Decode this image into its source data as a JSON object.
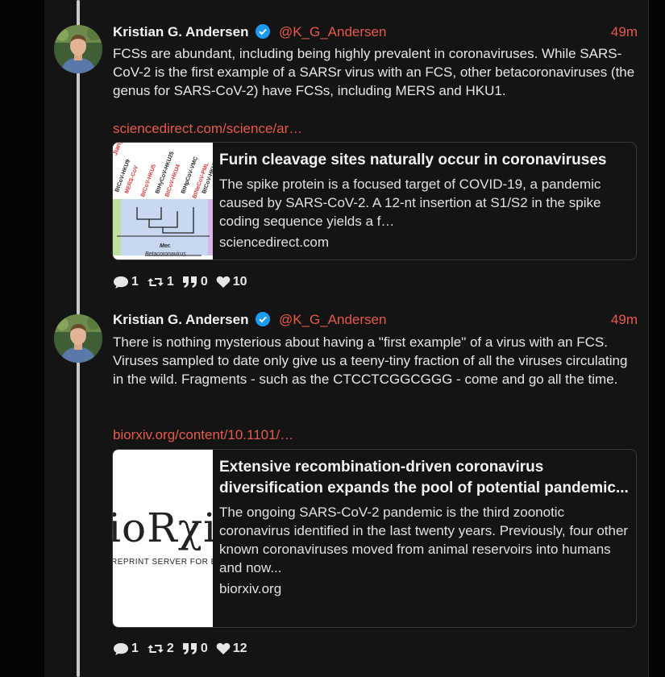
{
  "tweets": [
    {
      "author_name": "Kristian G. Andersen",
      "handle": "@K_G_Andersen",
      "time": "49m",
      "text": "FCSs are abundant, including being highly prevalent in coronaviruses. While SARS-CoV-2 is the first example of a SARSr virus with an FCS, other betacoronaviruses (the genus for SARS-CoV-2) have FCSs, including MERS and HKU1.",
      "link": "sciencedirect.com/science/ar…",
      "card": {
        "title": "Furin cleavage sites naturally occur in coronaviruses",
        "description": "The spike protein is a focused target of COVID-19, a pandemic caused by SARS-CoV-2. A 12-nt insertion at S1/S2 in the spike coding sequence yields a f…",
        "domain": "sciencedirect.com",
        "thumb_labels": [
          "Jiang2013",
          "BtCoV-HKU9",
          "MERS-CoV",
          "BtCoV-HKU5",
          "BtCoV-HKU4",
          "BtHyCoV-HKU25",
          "BtHpCoV-VMC",
          "BtCoV-HKU2",
          "BtNeCoV-PML",
          "Mer.",
          "Betacoronavirus"
        ]
      },
      "counts": {
        "replies": "1",
        "retweets": "1",
        "quotes": "0",
        "likes": "10"
      }
    },
    {
      "author_name": "Kristian G. Andersen",
      "handle": "@K_G_Andersen",
      "time": "49m",
      "text": "There is nothing mysterious about having a \"first example\" of a virus with an FCS. Viruses sampled to date only give us a teeny-tiny fraction of all the viruses circulating in the wild. Fragments - such as the CTCCTCGGCGGG - come and go all the time.",
      "link": "biorxiv.org/content/10.1101/…",
      "card": {
        "title": "Extensive recombination-driven coronavirus diversification expands the pool of potential pandemic...",
        "description": "The ongoing SARS-CoV-2 pandemic is the third zoonotic coronavirus identified in the last twenty years. Previously, four other known coronaviruses moved from animal reservoirs into humans and now...",
        "domain": "biorxiv.org",
        "thumb_logo": "ioRχi",
        "thumb_tagline": "REPRINT SERVER FOR BI"
      },
      "counts": {
        "replies": "1",
        "retweets": "2",
        "quotes": "0",
        "likes": "12"
      }
    }
  ],
  "colors": {
    "accent": "#e8594a",
    "background": "#141414",
    "verified": "#1d9bf0"
  },
  "icons": [
    "avatar-photo",
    "verified-icon",
    "reply-icon",
    "retweet-icon",
    "quote-icon",
    "heart-icon"
  ]
}
